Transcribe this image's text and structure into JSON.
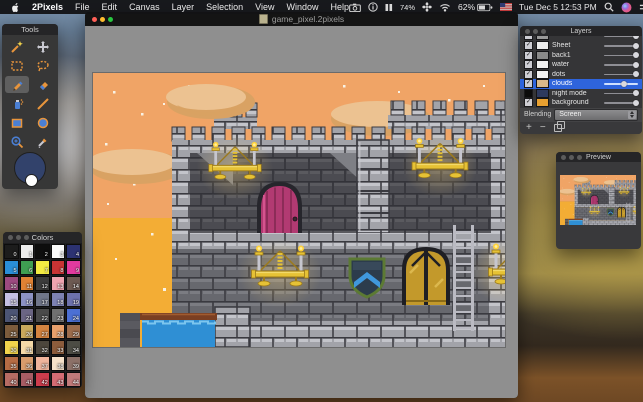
{
  "menu_bar": {
    "app_name": "2Pixels",
    "menus": [
      "File",
      "Edit",
      "Canvas",
      "Layer",
      "Selection",
      "View",
      "Window",
      "Help"
    ],
    "status": {
      "cpu_percent": "74%",
      "battery_percent": "62%",
      "clock": "Tue Dec 5 12:53 PM"
    }
  },
  "tools_window": {
    "title": "Tools",
    "tools": [
      {
        "name": "magic-wand",
        "selected": false
      },
      {
        "name": "move",
        "selected": false
      },
      {
        "name": "select-rect",
        "selected": false
      },
      {
        "name": "select-lasso",
        "selected": false
      },
      {
        "name": "pencil",
        "selected": true
      },
      {
        "name": "eraser",
        "selected": false
      },
      {
        "name": "spray",
        "selected": false
      },
      {
        "name": "line",
        "selected": false
      },
      {
        "name": "rect-shape",
        "selected": false
      },
      {
        "name": "ellipse-shape",
        "selected": false
      },
      {
        "name": "zoom",
        "selected": false
      },
      {
        "name": "eyedropper",
        "selected": false
      }
    ],
    "primary_color": "#32426b",
    "secondary_color": "#ffffff"
  },
  "colors_window": {
    "title": "Colors",
    "swatches": [
      "#1c1c1c",
      "#ececec",
      "#0d0d0d",
      "#fafafa",
      "#2c3272",
      "#2a8fd8",
      "#3f9e52",
      "#f2ea43",
      "#c93434",
      "#e23a9e",
      "#9c4a80",
      "#e08234",
      "#3c3c3c",
      "#efa4b0",
      "#6d5a52",
      "#c5c0e4",
      "#8d92c4",
      "#70768a",
      "#7d82b4",
      "#6d72ac",
      "#4c5574",
      "#6b6584",
      "#4a4a4a",
      "#707070",
      "#4c70d4",
      "#7c5c3c",
      "#c9a85c",
      "#d48440",
      "#e8a06c",
      "#9c6c4c",
      "#f2d44c",
      "#f5daa8",
      "#4c463c",
      "#8c5c3c",
      "#4c4c44",
      "#b66c44",
      "#d89c6c",
      "#f0b49c",
      "#f5e1c9",
      "#8c7168",
      "#b66c64",
      "#a85c64",
      "#cc3c4c",
      "#d46c74",
      "#c17a7a"
    ]
  },
  "canvas_window": {
    "title": "game_pixel.2pixels",
    "scene": {
      "palette": {
        "sky": "#f0a466",
        "ground": "#f3ad35",
        "cloud": "#ecc291",
        "cloudSh": "#d9a263",
        "star": "#f8f2e6",
        "joint": "#3a3a40",
        "wallLight": "#a2a3a9",
        "wallLightHi": "#c9cad0",
        "wallMid": "#7e7f85",
        "wallMidHi": "#97989e",
        "wallDark": "#4b4b51",
        "wallDarkHi": "#5d5d63",
        "wallLow": "#67686e",
        "wallLowHi": "#7f8086",
        "gold": "#e6c235",
        "goldDark": "#9c7a1c",
        "silver": "#c6c6ce",
        "flame": "#ffd23c",
        "flameCore": "#fff0a0",
        "doorFrame": "#26262c",
        "door": "#b23a72",
        "doorDark": "#8c2c58",
        "doorHi": "#d4548e",
        "winFrame": "#1f1f24",
        "win": "#c3992b",
        "winHi": "#dcb84e",
        "winDark": "#8a6a16",
        "shieldBorder": "#5c7a34",
        "shield": "#2c3c4c",
        "chevron": "#4098dc",
        "ladder": "#babac2",
        "water": "#2f8fd4",
        "waterHi": "#7cc6ee",
        "beam": "#7a3f22",
        "beamHi": "#a05c30",
        "steps": "#505056"
      }
    }
  },
  "layers_window": {
    "title": "Layers",
    "layers": [
      {
        "name": "",
        "clipped": true,
        "checked": true,
        "opacity": 100,
        "thumb": "#9a9a9a"
      },
      {
        "name": "Sheet",
        "checked": true,
        "opacity": 100,
        "thumb": "#ececec"
      },
      {
        "name": "back1",
        "checked": true,
        "opacity": 100,
        "thumb": "#8a8a8a"
      },
      {
        "name": "water",
        "checked": true,
        "opacity": 100,
        "thumb": "#f2f2f2"
      },
      {
        "name": "dots",
        "checked": true,
        "opacity": 100,
        "thumb": "#f2f2f2"
      },
      {
        "name": "clouds",
        "checked": true,
        "opacity": 65,
        "thumb": "#d9b98a",
        "selected": true
      },
      {
        "name": "night mode",
        "checked": false,
        "opacity": 100,
        "thumb": "#2e3a5e"
      },
      {
        "name": "background",
        "checked": true,
        "opacity": 100,
        "thumb": "#e8a030"
      }
    ],
    "blending_label": "Blending",
    "blending_value": "Screen"
  },
  "preview_window": {
    "title": "Preview"
  }
}
